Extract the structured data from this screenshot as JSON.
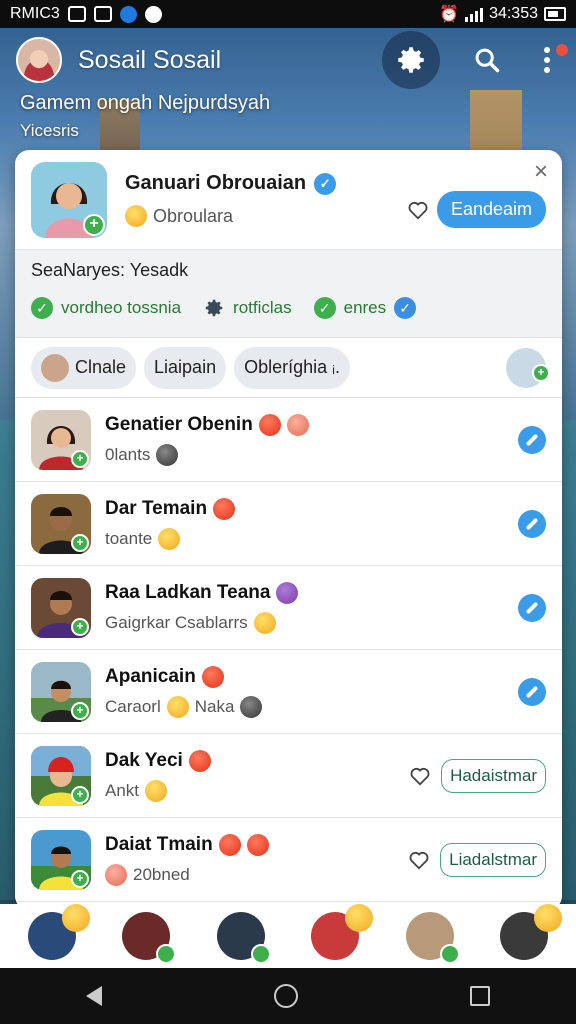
{
  "status_bar": {
    "carrier": "RMIC3",
    "time": "34:353"
  },
  "header": {
    "app_title": "Sosail Sosail",
    "subtitle_line1": "Gamem ongah Nejpurdsyah",
    "subtitle_line2": "Yicesris"
  },
  "profile": {
    "name": "Ganuari Obrouaian",
    "sub": "Obroulara",
    "action_label": "Eandeaim",
    "close_icon": "×"
  },
  "stats": {
    "title": "SeaNaryes: Yesadk",
    "items": [
      {
        "label": "vordheo tossnia",
        "icon": "check-icon"
      },
      {
        "label": "rotficlas",
        "icon": "gear-icon"
      },
      {
        "label": "enres",
        "icon": "check-icon"
      }
    ]
  },
  "chips": [
    {
      "label": "Clnale"
    },
    {
      "label": "Liaipain"
    },
    {
      "label": "Obleríghia ᵢ."
    }
  ],
  "contacts": [
    {
      "name": "Genatier Obenin",
      "sub": "0lants",
      "action": "edit"
    },
    {
      "name": "Dar Temain",
      "sub": "toante",
      "action": "edit"
    },
    {
      "name": "Raa Ladkan Teana",
      "sub": "Gaigrkar Csablarrs",
      "action": "edit"
    },
    {
      "name": "Apanicain",
      "sub": "Caraorl",
      "sub2": "Naka",
      "action": "edit"
    },
    {
      "name": "Dak Yeci",
      "sub": "Ankt",
      "action": "Hadaistmar"
    },
    {
      "name": "Daiat Tmain",
      "sub": "20bned",
      "action": "Liadalstmar"
    }
  ],
  "colors": {
    "accent": "#3a9be8",
    "green": "#3fae4d"
  }
}
